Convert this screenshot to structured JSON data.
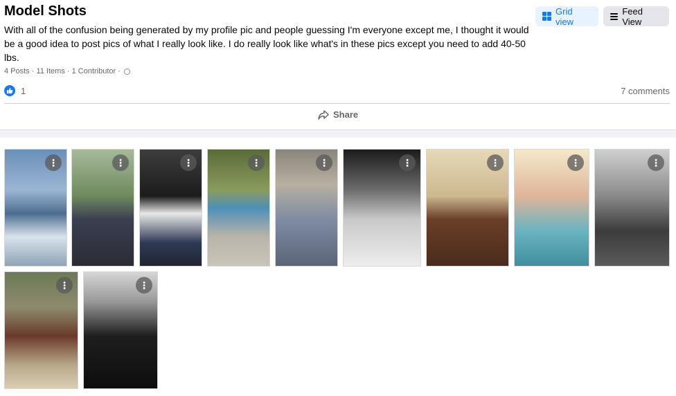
{
  "album": {
    "title": "Model Shots",
    "description": "With all of the confusion being generated by my profile pic and people guessing I'm everyone except me, I thought it would be a good idea to post pics of what I really look like. I do really look like what's in these pics except you need to add 40-50 lbs.",
    "meta": "4 Posts · 11 Items · 1 Contributor ·"
  },
  "view_buttons": {
    "grid_label": "Grid view",
    "feed_label": "Feed View"
  },
  "reactions": {
    "like_count": "1",
    "comments": "7 comments",
    "share_label": "Share"
  },
  "photos": [
    {
      "name": "photo-beach",
      "bg": "linear-gradient(180deg,#6a8fb8 0%,#9bb6d3 35%,#4c6d91 55%,#d9e3ec 75%,#8ea4b8 100%)"
    },
    {
      "name": "photo-fence",
      "bg": "linear-gradient(180deg,#a7b99a 0%,#6e8a5e 40%,#3a3f52 60%,#2b2b33 100%)"
    },
    {
      "name": "photo-chainlink",
      "bg": "linear-gradient(180deg,#3d3d3d 0%,#1c1c1c 40%,#e8e8e8 55%,#2f3a55 80%,#1f2433 100%)"
    },
    {
      "name": "photo-road",
      "bg": "linear-gradient(180deg,#5a6b3a 0%,#8a9b5e 35%,#4f8fb8 50%,#b9b4a8 75%,#c9c4b9 100%)"
    },
    {
      "name": "photo-suit-wall",
      "bg": "linear-gradient(180deg,#8a857c 0%,#b7b0a2 30%,#7f8ca3 60%,#5b6479 100%)"
    },
    {
      "name": "photo-portrait-bw",
      "bg": "linear-gradient(180deg,#1b1b1b 0%,#6d6d6d 35%,#c9c9c9 60%,#ededed 100%)"
    },
    {
      "name": "photo-leather-coat",
      "bg": "linear-gradient(180deg,#e6d9b8 0%,#cdb890 40%,#6a3f28 60%,#4a2b1c 100%)"
    },
    {
      "name": "photo-couple-color",
      "bg": "linear-gradient(180deg,#f3e9c9 0%,#e0b59a 40%,#6ab3c0 70%,#3f8fa0 100%)"
    },
    {
      "name": "photo-couple-bw",
      "bg": "linear-gradient(180deg,#cfcfcf 0%,#8a8a8a 40%,#3c3c3c 70%,#5a5a5a 100%)"
    },
    {
      "name": "photo-woods",
      "bg": "linear-gradient(180deg,#6b7a55 0%,#8f8a6e 30%,#6a3a2a 55%,#b8a888 80%,#d9cdb3 100%)"
    },
    {
      "name": "photo-tuxedo",
      "bg": "linear-gradient(180deg,#d6d6d6 0%,#9a9a9a 25%,#1e1e1e 55%,#0d0d0d 100%)"
    }
  ],
  "icons": {
    "grid": "grid-icon",
    "feed": "list-icon",
    "like": "thumbs-up-icon",
    "share": "share-arrow-icon",
    "more": "more-dots-icon",
    "privacy": "globe-icon"
  },
  "colors": {
    "accent": "#1877f2",
    "grid_button_bg": "#e7f3ff",
    "feed_button_bg": "#e4e6eb",
    "muted_text": "#65676b"
  }
}
